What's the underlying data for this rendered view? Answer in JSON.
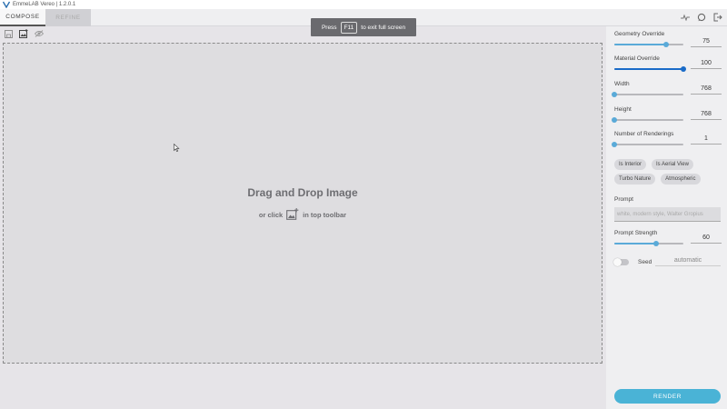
{
  "window": {
    "title": "EmmeLAB Vereo | 1.2.0.1"
  },
  "tabs": [
    {
      "label": "COMPOSE",
      "active": true
    },
    {
      "label": "REFINE",
      "active": false
    }
  ],
  "tab_icons": [
    "graph-icon",
    "chat-icon",
    "logout-icon"
  ],
  "toast": {
    "prefix": "Press",
    "key": "F11",
    "suffix": "to exit full screen"
  },
  "toolbar": {
    "icons": [
      "save-icon",
      "add-image-icon",
      "hide-icon"
    ]
  },
  "canvas": {
    "title": "Drag and Drop Image",
    "sub_prefix": "or click",
    "sub_suffix": "in top toolbar"
  },
  "panel": {
    "fields": [
      {
        "label": "Geometry Override",
        "value": "75",
        "fraction": 0.75
      },
      {
        "label": "Material Override",
        "value": "100",
        "fraction": 1.0
      },
      {
        "label": "Width",
        "value": "768",
        "fraction": 0.0
      },
      {
        "label": "Height",
        "value": "768",
        "fraction": 0.0
      },
      {
        "label": "Number of Renderings",
        "value": "1",
        "fraction": 0.0
      }
    ],
    "chips": [
      "Is Interior",
      "Is Aerial View",
      "Turbo Nature",
      "Atmospheric"
    ],
    "prompt": {
      "label": "Prompt",
      "placeholder": "white, modern style, Walter Gropius"
    },
    "strength": {
      "label": "Prompt Strength",
      "value": "60",
      "fraction": 0.6
    },
    "seed": {
      "label": "Seed",
      "value": "automatic",
      "enabled": false
    },
    "render_label": "RENDER"
  },
  "colors": {
    "accent": "#4ab3d6",
    "slider_active": "#1a6bc8",
    "toast_bg": "#6a6a6e"
  }
}
